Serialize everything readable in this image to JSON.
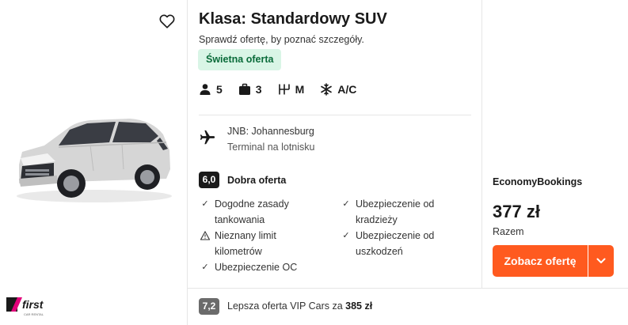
{
  "listing": {
    "title": "Klasa: Standardowy SUV",
    "subtitle": "Sprawdź ofertę, by poznać szczegóły.",
    "badge": "Świetna oferta",
    "specs": {
      "passengers": "5",
      "bags": "3",
      "transmission": "M",
      "ac": "A/C"
    },
    "location": {
      "line1": "JNB: Johannesburg",
      "line2": "Terminal na lotnisku"
    },
    "rating": {
      "score": "6,0",
      "label": "Dobra oferta"
    },
    "features_left": [
      {
        "icon": "check-icon",
        "text1": "Dogodne zasady",
        "text2": "tankowania"
      },
      {
        "icon": "warning-icon",
        "text1": "Nieznany limit",
        "text2": "kilometrów"
      },
      {
        "icon": "check-icon",
        "text1": "Ubezpieczenie OC",
        "text2": ""
      }
    ],
    "features_right": [
      {
        "icon": "check-icon",
        "text1": "Ubezpieczenie od",
        "text2": "kradzieży"
      },
      {
        "icon": "check-icon",
        "text1": "Ubezpieczenie od",
        "text2": "uszkodzeń"
      }
    ]
  },
  "supplier": {
    "logo_text": "first",
    "logo_sub": "CAR RENTAL"
  },
  "offer": {
    "provider": "EconomyBookings",
    "price": "377 zł",
    "price_label": "Razem",
    "cta": "Zobacz ofertę"
  },
  "alt_offer": {
    "score": "7,2",
    "text": "Lepsza oferta VIP Cars za ",
    "price": "385 zł"
  },
  "colors": {
    "accent": "#ff5a1f",
    "badge_bg": "#d9f5e6",
    "badge_text": "#0a6b3a"
  }
}
